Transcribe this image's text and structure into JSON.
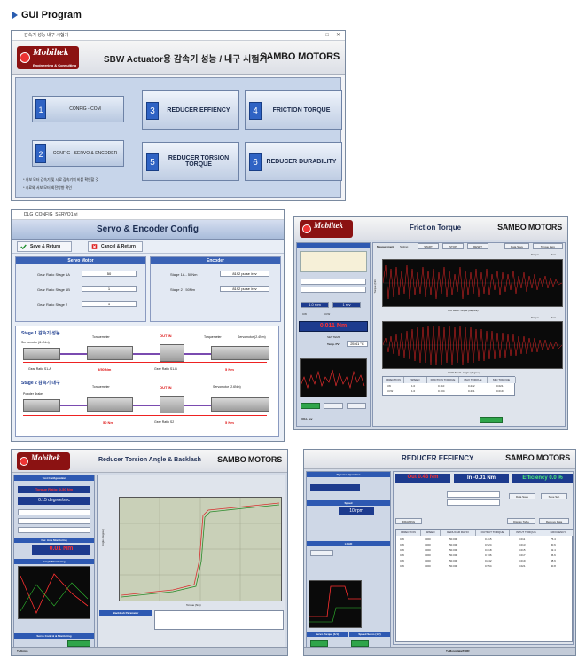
{
  "heading": "GUI Program",
  "main_window": {
    "titlebar": "감속기 성능 내구 시험기",
    "title": "SBW Actuator용 감속기 성능 / 내구 시험기",
    "logo": "Mobiltek",
    "logo_sub": "Engineering & Consulting",
    "brand": "SAMBO MOTORS",
    "config_buttons": [
      {
        "num": "1",
        "label": "CONFIG - COM"
      },
      {
        "num": "2",
        "label": "CONFIG - SERVO & ENCODER"
      }
    ],
    "test_buttons": [
      {
        "num": "3",
        "label": "REDUCER EFFIENCY"
      },
      {
        "num": "4",
        "label": "FRICTION TORQUE"
      },
      {
        "num": "5",
        "label": "REDUCER TORSION TORQUE"
      },
      {
        "num": "6",
        "label": "REDUCER DURABILITY"
      }
    ],
    "notes": [
      "* 서보 모터 감속기 및 시료 감속기의 비를 확인할 것",
      "* 시료와 서보 모터 회전방향 확인"
    ]
  },
  "config_window": {
    "titlebar": "DLG_CONFIG_SERVO1.vi",
    "title": "Servo & Encoder Config",
    "save_label": "Save & Return",
    "cancel_label": "Cancel & Return",
    "servo_motor": {
      "header": "Servo Motor",
      "rows": [
        {
          "label": "Gear Ratio Stage 1A",
          "value": "50"
        },
        {
          "label": "Gear Ratio Stage 1B",
          "value": "1"
        },
        {
          "label": "Gear Ratio Stage 2",
          "value": "1"
        }
      ]
    },
    "encoder": {
      "header": "Encoder",
      "rows": [
        {
          "label": "Stage 1A - 50Nm",
          "value": "8192 pulse /rev"
        },
        {
          "label": "Stage 2 - 50Nm",
          "value": "8192 pulse /rev"
        }
      ]
    },
    "diagram": {
      "stage1": "Stage 1 감속기 성능",
      "stage2": "Stage 2 감속기 내구",
      "servomotor": "Servomotor (6.4Nm)",
      "torquemeter": "Torquemeter",
      "torquemeter2": "Torquemeter",
      "servomotor2": "Servomotor (2.4Nm)",
      "servomotor3": "Servomotor (2.6Nm)",
      "gear_ratio_s1a": "Gear Ratio S1-A",
      "gear_ratio_s1b": "Gear Ratio S1-B",
      "gear_ratio_s2": "Gear Ratio S2",
      "torque1": "5/50 Nm",
      "torque2": "5 Nm",
      "torque3": "50 Nm",
      "torque4": "5 Nm",
      "out_in_1": "OUT    IN",
      "out_in_2": "OUT    IN",
      "powder_brake": "Powder Brake"
    }
  },
  "friction_window": {
    "title": "Friction Torque",
    "logo": "Mobiltek",
    "brand": "SAMBO MOTORS",
    "tabs": [
      "Measurement",
      "Setting"
    ],
    "start": "START",
    "stop": "STOP",
    "reset": "RESET",
    "data_save": "Data Save",
    "torque_zero": "Torque Zero",
    "legend_torque": "Torque",
    "legend_raw": "Raw",
    "xlabel_top": "CW Mech. Angle (degree)",
    "xlabel_bottom": "CCW Mech. Angle (degree)",
    "ylabel": "Torque (Nm)",
    "speed1": "1.0 rpm",
    "speed2": "1 rev",
    "cw": "CW",
    "ccw": "CCW",
    "torque_value": "0.011 Nm",
    "temp_label": "Temp. PV",
    "temp_value": "25.41 °C",
    "set_temp": "SET TEMP",
    "status": "COLL rev",
    "table_headers": [
      "DIRECTION",
      "SPEED",
      "FRICTION TORQUE",
      "MAX TORQUE",
      "MIN TORQUE"
    ],
    "table_rows": [
      [
        "CW",
        "1.0",
        "0.110",
        "0.242",
        "0.021"
      ],
      [
        "CCW",
        "1.0",
        "0.104",
        "0.231",
        "0.019"
      ]
    ]
  },
  "torsion_window": {
    "title": "Reducer Torsion Angle & Backlash",
    "logo": "Mobiltek",
    "brand": "SAMBO MOTORS",
    "test_config": "Test Configuration",
    "torque_value": "0.01 Nm",
    "test_mode": "Torque Ratio: 0-50 Nm",
    "speed": "0.15 degree/sec",
    "cur_monitor": "Cur. Axis Monitoring",
    "graph_monitor": "Graph Monitoring",
    "backlash_param": "Backlash Parameter",
    "servo_control": "Servo Control & Monitoring",
    "xlabel": "Torque (Nm)",
    "ylabel": "Angle (degree)",
    "status": "T+Finish"
  },
  "efficiency_window": {
    "title": "REDUCER EFFIENCY",
    "brand": "SAMBO MOTORS",
    "out_value": "Out 0.43 Nm",
    "in_value": "In -0.01 Nm",
    "efficiency": "Efficiency 0.0 %",
    "dynamo": "Dynamo Operation",
    "speed_label": "Speed",
    "speed_value": "10 rpm",
    "load_label": "LOAD",
    "data_save": "Data Save",
    "save_sel": "Save Sel.",
    "reset_label": "RESET",
    "display_table": "Display Table",
    "remove_data": "Remove Data",
    "drawing": "DRAWING",
    "table_headers": [
      "DIRECTION",
      "SPEED",
      "REDUCER RATIO",
      "OUTPUT TORQUE",
      "INPUT TORQUE",
      "EFFICIENCY"
    ],
    "table_rows": [
      [
        "CW",
        "3000",
        "50.000",
        "0.415",
        "0.011",
        "75.4"
      ],
      [
        "CW",
        "3000",
        "50.000",
        "0.524",
        "0.013",
        "80.6"
      ],
      [
        "CW",
        "3000",
        "50.000",
        "0.618",
        "0.015",
        "82.4"
      ],
      [
        "CW",
        "3000",
        "50.000",
        "0.736",
        "0.017",
        "86.6"
      ],
      [
        "CW",
        "3000",
        "50.000",
        "0.842",
        "0.019",
        "88.6"
      ],
      [
        "CW",
        "3000",
        "50.000",
        "0.954",
        "0.021",
        "90.8"
      ]
    ],
    "servo_torque": "Servo Torque (1/1)",
    "speed_servo": "Speed Servo (1/2)",
    "status": "T+MonoData/TaRR"
  },
  "colors": {
    "accent": "#2f63c4",
    "brand_red": "#8b1212",
    "plot_red": "#e52525",
    "plot_bg": "#0a0a0a"
  }
}
